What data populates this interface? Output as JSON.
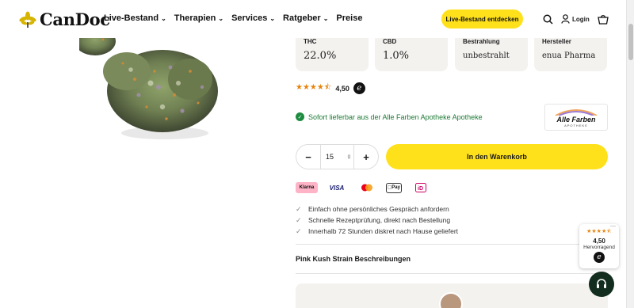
{
  "header": {
    "logo_text": "CanDoc",
    "nav": [
      {
        "label": "Live-Bestand",
        "dropdown": true
      },
      {
        "label": "Therapien",
        "dropdown": true
      },
      {
        "label": "Services",
        "dropdown": true
      },
      {
        "label": "Ratgeber",
        "dropdown": true
      },
      {
        "label": "Preise",
        "dropdown": false
      }
    ],
    "cta_label": "Live-Bestand entdecken",
    "login_label": "Login"
  },
  "specs": [
    {
      "label": "THC",
      "value": "22.0%"
    },
    {
      "label": "CBD",
      "value": "1.0%"
    },
    {
      "label": "Bestrahlung",
      "value": "unbestrahlt"
    },
    {
      "label": "Hersteller",
      "value": "enua Pharma"
    }
  ],
  "rating": {
    "stars": "★★★★⯪",
    "value": "4,50"
  },
  "availability": {
    "text": "Sofort lieferbar aus der Alle Farben Apotheke Apotheke"
  },
  "pharmacy": {
    "name": "Alle Farben",
    "sub": "APOTHEKE"
  },
  "quantity": {
    "value": "15",
    "unit": "g",
    "minus": "−",
    "plus": "+"
  },
  "cart_button": "In den Warenkorb",
  "payments": [
    {
      "label": "Klarna",
      "bg": "#ffb3c7",
      "color": "#111"
    },
    {
      "label": "VISA",
      "bg": "#ffffff",
      "color": "#1a1f71"
    },
    {
      "label": "mastercard",
      "bg": "#ffffff",
      "color": "#eb001b"
    },
    {
      "label": "Pay",
      "bg": "#ffffff",
      "color": "#111"
    },
    {
      "label": "iD",
      "bg": "#ffffff",
      "color": "#cc0066"
    }
  ],
  "benefits": [
    "Einfach ohne persönliches Gespräch anfordern",
    "Schnelle Rezeptprüfung, direkt nach Bestellung",
    "Innerhalb 72 Stunden diskret nach Hause geliefert"
  ],
  "description_title": "Pink Kush Strain Beschreibungen",
  "review_widget": {
    "stars": "★★★★⯪",
    "score": "4,50",
    "label": "Hervorragend",
    "close": "—"
  },
  "colors": {
    "accent": "#ffe11b",
    "success": "#1d8c3f",
    "star": "#e8830c"
  }
}
